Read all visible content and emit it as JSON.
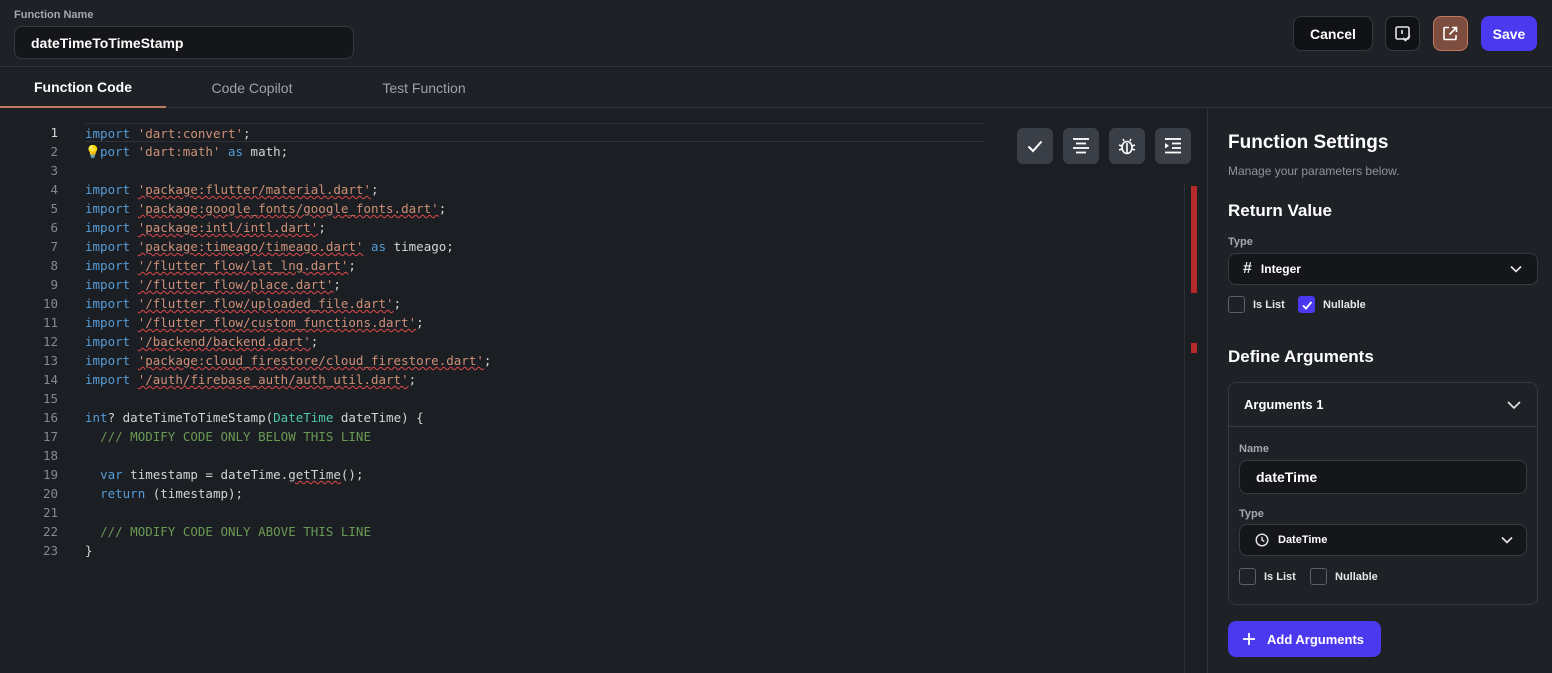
{
  "header": {
    "function_name_label": "Function Name",
    "function_name_value": "dateTimeToTimeStamp",
    "cancel_label": "Cancel",
    "save_label": "Save"
  },
  "tabs": [
    {
      "label": "Function Code",
      "active": true
    },
    {
      "label": "Code Copilot",
      "active": false
    },
    {
      "label": "Test Function",
      "active": false
    }
  ],
  "editor": {
    "line_numbers": [
      "1",
      "2",
      "3",
      "4",
      "5",
      "6",
      "7",
      "8",
      "9",
      "10",
      "11",
      "12",
      "13",
      "14",
      "15",
      "16",
      "17",
      "18",
      "19",
      "20",
      "21",
      "22",
      "23"
    ],
    "code": {
      "l1_kw": "import",
      "l1_str": "'dart:convert'",
      "l1_end": ";",
      "l2_kw": "port",
      "l2_str": "'dart:math'",
      "l2_as": "as",
      "l2_end": " math;",
      "l4_kw": "import",
      "l4_str": "'package:flutter/material.dart'",
      "l4_end": ";",
      "l5_kw": "import",
      "l5_str": "'package:google_fonts/google_fonts.dart'",
      "l5_end": ";",
      "l6_kw": "import",
      "l6_str": "'package:intl/intl.dart'",
      "l6_end": ";",
      "l7_kw": "import",
      "l7_str": "'package:timeago/timeago.dart'",
      "l7_as": "as",
      "l7_end": " timeago;",
      "l8_kw": "import",
      "l8_str": "'/flutter_flow/lat_lng.dart'",
      "l8_end": ";",
      "l9_kw": "import",
      "l9_str": "'/flutter_flow/place.dart'",
      "l9_end": ";",
      "l10_kw": "import",
      "l10_str": "'/flutter_flow/uploaded_file.dart'",
      "l10_end": ";",
      "l11_kw": "import",
      "l11_str": "'/flutter_flow/custom_functions.dart'",
      "l11_end": ";",
      "l12_kw": "import",
      "l12_str": "'/backend/backend.dart'",
      "l12_end": ";",
      "l13_kw": "import",
      "l13_str": "'package:cloud_firestore/cloud_firestore.dart'",
      "l13_end": ";",
      "l14_kw": "import",
      "l14_str": "'/auth/firebase_auth/auth_util.dart'",
      "l14_end": ";",
      "l16_type": "int",
      "l16_a": "? dateTimeToTimeStamp(",
      "l16_type2": "DateTime",
      "l16_b": " dateTime) {",
      "l17_cmt": "/// MODIFY CODE ONLY BELOW THIS LINE",
      "l19_kw": "var",
      "l19_a": " timestamp = dateTime.",
      "l19_fn": "getTime",
      "l19_b": "();",
      "l20_kw": "return",
      "l20_a": " (timestamp);",
      "l22_cmt": "/// MODIFY CODE ONLY ABOVE THIS LINE",
      "l23": "}"
    }
  },
  "settings": {
    "title": "Function Settings",
    "subtitle": "Manage your parameters below.",
    "return_value_heading": "Return Value",
    "type_label": "Type",
    "return_type": "Integer",
    "is_list_label": "Is List",
    "nullable_label": "Nullable",
    "return_is_list": false,
    "return_nullable": true,
    "define_arguments_heading": "Define Arguments",
    "argument": {
      "header": "Arguments 1",
      "name_label": "Name",
      "name_value": "dateTime",
      "type_label": "Type",
      "type_value": "DateTime",
      "is_list_label": "Is List",
      "nullable_label": "Nullable",
      "is_list": false,
      "nullable": false
    },
    "add_arguments_label": "Add Arguments"
  },
  "icons": {
    "publish": "checklist-icon",
    "open": "open-external-icon",
    "tools": [
      "check-icon",
      "format-align-icon",
      "bug-icon",
      "indent-icon"
    ],
    "return_type_icon": "hash-icon",
    "arg_type_icon": "clock-icon"
  },
  "colors": {
    "accent": "#4b39ef",
    "tab_underline": "#c07a5f",
    "error": "#b52a2a"
  }
}
